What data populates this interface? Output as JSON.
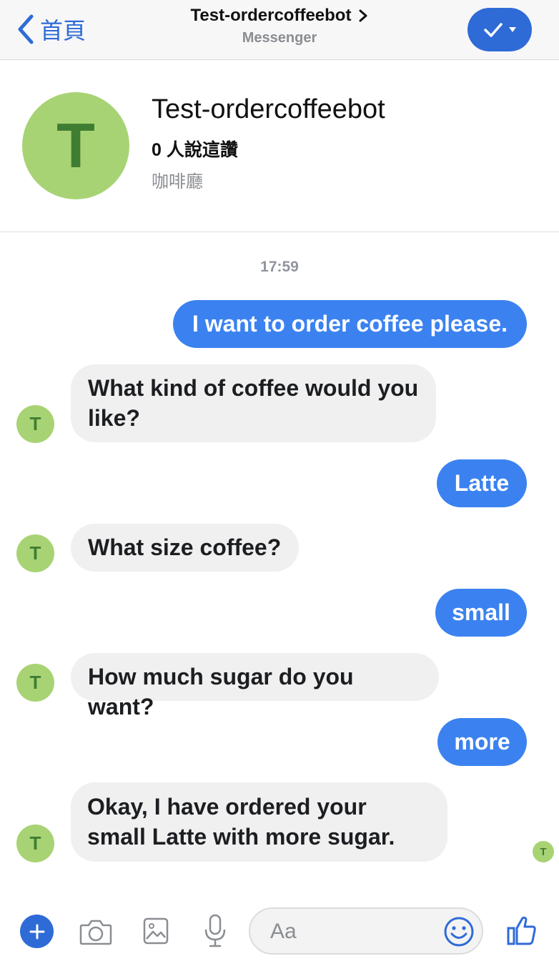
{
  "header": {
    "back_label": "首頁",
    "title": "Test-ordercoffeebot",
    "subtitle": "Messenger"
  },
  "profile": {
    "avatar_letter": "T",
    "name": "Test-ordercoffeebot",
    "likes": "0 人說這讚",
    "category": "咖啡廳"
  },
  "conversation": {
    "timestamp": "17:59",
    "bot_initial": "T",
    "messages": [
      {
        "from": "user",
        "text": "I want to order coffee please."
      },
      {
        "from": "bot",
        "text": "What kind of coffee would you like?"
      },
      {
        "from": "user",
        "text": "Latte"
      },
      {
        "from": "bot",
        "text": "What size coffee?"
      },
      {
        "from": "user",
        "text": "small"
      },
      {
        "from": "bot",
        "text": "How much sugar do you want?"
      },
      {
        "from": "user",
        "text": "more"
      },
      {
        "from": "bot",
        "text": "Okay, I have ordered your small Latte with more sugar."
      }
    ]
  },
  "composer": {
    "placeholder": "Aa",
    "icons": [
      "plus-icon",
      "camera-icon",
      "image-icon",
      "microphone-icon",
      "emoji-icon",
      "thumbs-up-icon"
    ]
  },
  "colors": {
    "accent": "#2f6bd7",
    "outgoing_bubble": "#3b82f0",
    "incoming_bubble": "#f0f0f0",
    "avatar_bg": "#a8d374",
    "avatar_letter": "#3f7d32"
  }
}
